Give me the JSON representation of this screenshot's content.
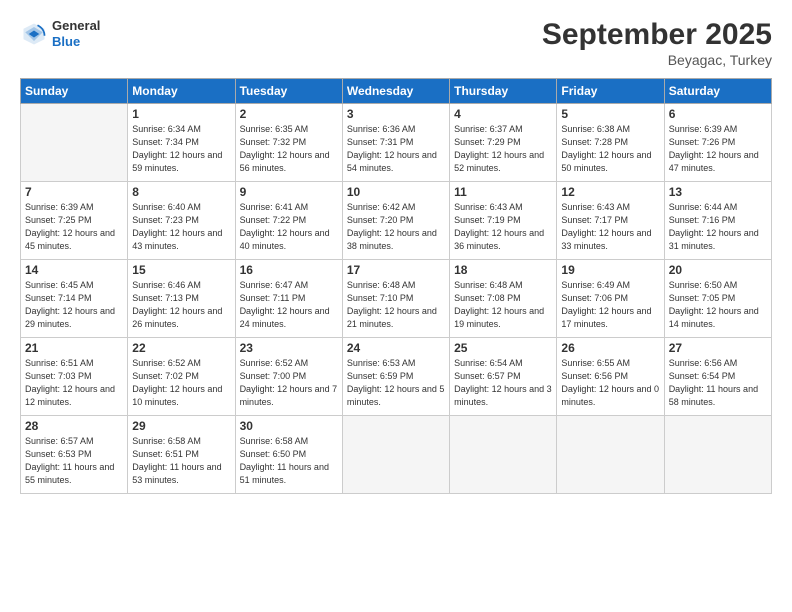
{
  "header": {
    "logo_general": "General",
    "logo_blue": "Blue",
    "month": "September 2025",
    "location": "Beyagac, Turkey"
  },
  "days_of_week": [
    "Sunday",
    "Monday",
    "Tuesday",
    "Wednesday",
    "Thursday",
    "Friday",
    "Saturday"
  ],
  "weeks": [
    [
      {
        "day": "",
        "sunrise": "",
        "sunset": "",
        "daylight": "",
        "empty": true
      },
      {
        "day": "1",
        "sunrise": "Sunrise: 6:34 AM",
        "sunset": "Sunset: 7:34 PM",
        "daylight": "Daylight: 12 hours and 59 minutes."
      },
      {
        "day": "2",
        "sunrise": "Sunrise: 6:35 AM",
        "sunset": "Sunset: 7:32 PM",
        "daylight": "Daylight: 12 hours and 56 minutes."
      },
      {
        "day": "3",
        "sunrise": "Sunrise: 6:36 AM",
        "sunset": "Sunset: 7:31 PM",
        "daylight": "Daylight: 12 hours and 54 minutes."
      },
      {
        "day": "4",
        "sunrise": "Sunrise: 6:37 AM",
        "sunset": "Sunset: 7:29 PM",
        "daylight": "Daylight: 12 hours and 52 minutes."
      },
      {
        "day": "5",
        "sunrise": "Sunrise: 6:38 AM",
        "sunset": "Sunset: 7:28 PM",
        "daylight": "Daylight: 12 hours and 50 minutes."
      },
      {
        "day": "6",
        "sunrise": "Sunrise: 6:39 AM",
        "sunset": "Sunset: 7:26 PM",
        "daylight": "Daylight: 12 hours and 47 minutes."
      }
    ],
    [
      {
        "day": "7",
        "sunrise": "Sunrise: 6:39 AM",
        "sunset": "Sunset: 7:25 PM",
        "daylight": "Daylight: 12 hours and 45 minutes."
      },
      {
        "day": "8",
        "sunrise": "Sunrise: 6:40 AM",
        "sunset": "Sunset: 7:23 PM",
        "daylight": "Daylight: 12 hours and 43 minutes."
      },
      {
        "day": "9",
        "sunrise": "Sunrise: 6:41 AM",
        "sunset": "Sunset: 7:22 PM",
        "daylight": "Daylight: 12 hours and 40 minutes."
      },
      {
        "day": "10",
        "sunrise": "Sunrise: 6:42 AM",
        "sunset": "Sunset: 7:20 PM",
        "daylight": "Daylight: 12 hours and 38 minutes."
      },
      {
        "day": "11",
        "sunrise": "Sunrise: 6:43 AM",
        "sunset": "Sunset: 7:19 PM",
        "daylight": "Daylight: 12 hours and 36 minutes."
      },
      {
        "day": "12",
        "sunrise": "Sunrise: 6:43 AM",
        "sunset": "Sunset: 7:17 PM",
        "daylight": "Daylight: 12 hours and 33 minutes."
      },
      {
        "day": "13",
        "sunrise": "Sunrise: 6:44 AM",
        "sunset": "Sunset: 7:16 PM",
        "daylight": "Daylight: 12 hours and 31 minutes."
      }
    ],
    [
      {
        "day": "14",
        "sunrise": "Sunrise: 6:45 AM",
        "sunset": "Sunset: 7:14 PM",
        "daylight": "Daylight: 12 hours and 29 minutes."
      },
      {
        "day": "15",
        "sunrise": "Sunrise: 6:46 AM",
        "sunset": "Sunset: 7:13 PM",
        "daylight": "Daylight: 12 hours and 26 minutes."
      },
      {
        "day": "16",
        "sunrise": "Sunrise: 6:47 AM",
        "sunset": "Sunset: 7:11 PM",
        "daylight": "Daylight: 12 hours and 24 minutes."
      },
      {
        "day": "17",
        "sunrise": "Sunrise: 6:48 AM",
        "sunset": "Sunset: 7:10 PM",
        "daylight": "Daylight: 12 hours and 21 minutes."
      },
      {
        "day": "18",
        "sunrise": "Sunrise: 6:48 AM",
        "sunset": "Sunset: 7:08 PM",
        "daylight": "Daylight: 12 hours and 19 minutes."
      },
      {
        "day": "19",
        "sunrise": "Sunrise: 6:49 AM",
        "sunset": "Sunset: 7:06 PM",
        "daylight": "Daylight: 12 hours and 17 minutes."
      },
      {
        "day": "20",
        "sunrise": "Sunrise: 6:50 AM",
        "sunset": "Sunset: 7:05 PM",
        "daylight": "Daylight: 12 hours and 14 minutes."
      }
    ],
    [
      {
        "day": "21",
        "sunrise": "Sunrise: 6:51 AM",
        "sunset": "Sunset: 7:03 PM",
        "daylight": "Daylight: 12 hours and 12 minutes."
      },
      {
        "day": "22",
        "sunrise": "Sunrise: 6:52 AM",
        "sunset": "Sunset: 7:02 PM",
        "daylight": "Daylight: 12 hours and 10 minutes."
      },
      {
        "day": "23",
        "sunrise": "Sunrise: 6:52 AM",
        "sunset": "Sunset: 7:00 PM",
        "daylight": "Daylight: 12 hours and 7 minutes."
      },
      {
        "day": "24",
        "sunrise": "Sunrise: 6:53 AM",
        "sunset": "Sunset: 6:59 PM",
        "daylight": "Daylight: 12 hours and 5 minutes."
      },
      {
        "day": "25",
        "sunrise": "Sunrise: 6:54 AM",
        "sunset": "Sunset: 6:57 PM",
        "daylight": "Daylight: 12 hours and 3 minutes."
      },
      {
        "day": "26",
        "sunrise": "Sunrise: 6:55 AM",
        "sunset": "Sunset: 6:56 PM",
        "daylight": "Daylight: 12 hours and 0 minutes."
      },
      {
        "day": "27",
        "sunrise": "Sunrise: 6:56 AM",
        "sunset": "Sunset: 6:54 PM",
        "daylight": "Daylight: 11 hours and 58 minutes."
      }
    ],
    [
      {
        "day": "28",
        "sunrise": "Sunrise: 6:57 AM",
        "sunset": "Sunset: 6:53 PM",
        "daylight": "Daylight: 11 hours and 55 minutes."
      },
      {
        "day": "29",
        "sunrise": "Sunrise: 6:58 AM",
        "sunset": "Sunset: 6:51 PM",
        "daylight": "Daylight: 11 hours and 53 minutes."
      },
      {
        "day": "30",
        "sunrise": "Sunrise: 6:58 AM",
        "sunset": "Sunset: 6:50 PM",
        "daylight": "Daylight: 11 hours and 51 minutes."
      },
      {
        "day": "",
        "sunrise": "",
        "sunset": "",
        "daylight": "",
        "empty": true
      },
      {
        "day": "",
        "sunrise": "",
        "sunset": "",
        "daylight": "",
        "empty": true
      },
      {
        "day": "",
        "sunrise": "",
        "sunset": "",
        "daylight": "",
        "empty": true
      },
      {
        "day": "",
        "sunrise": "",
        "sunset": "",
        "daylight": "",
        "empty": true
      }
    ]
  ]
}
